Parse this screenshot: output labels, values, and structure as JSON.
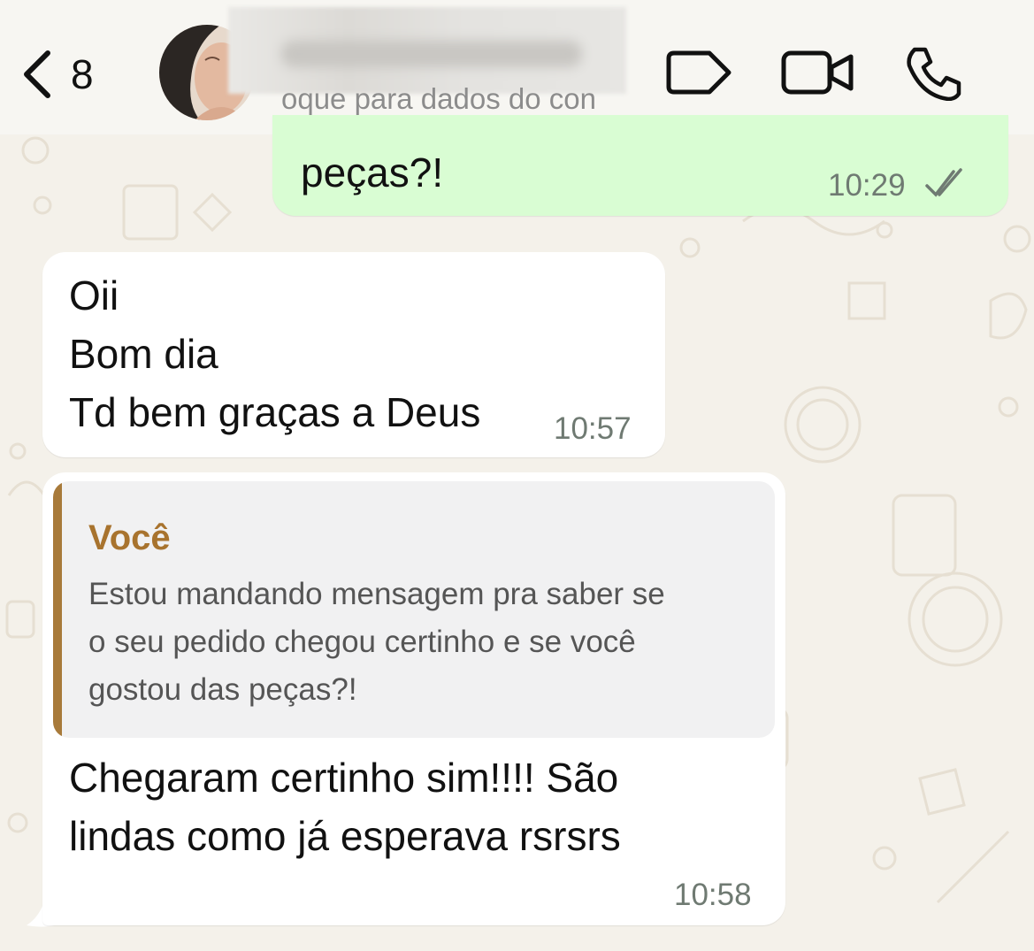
{
  "header": {
    "back_count": "8",
    "subtitle": "oque para dados do con",
    "icons": {
      "back": "chevron-left-icon",
      "tag": "label-tag-icon",
      "video": "video-call-icon",
      "phone": "phone-call-icon"
    }
  },
  "messages": {
    "outgoing": {
      "text": "peças?!",
      "time": "10:29",
      "status": "read"
    },
    "incoming1": {
      "lines": [
        "Oii",
        "Bom dia",
        "Td bem graças a Deus"
      ],
      "time": "10:57"
    },
    "incoming2": {
      "quote": {
        "author": "Você",
        "lines": [
          "Estou mandando mensagem pra saber se",
          "o seu pedido chegou certinho e se você",
          "gostou das peças?!"
        ]
      },
      "lines": [
        "Chegaram certinho sim!!!! São",
        "lindas como já esperava rsrsrs"
      ],
      "time": "10:58"
    }
  },
  "colors": {
    "outgoing_bubble": "#d9fdd3",
    "incoming_bubble": "#ffffff",
    "quote_accent": "#a8732e",
    "wallpaper": "#f4f1ea"
  }
}
